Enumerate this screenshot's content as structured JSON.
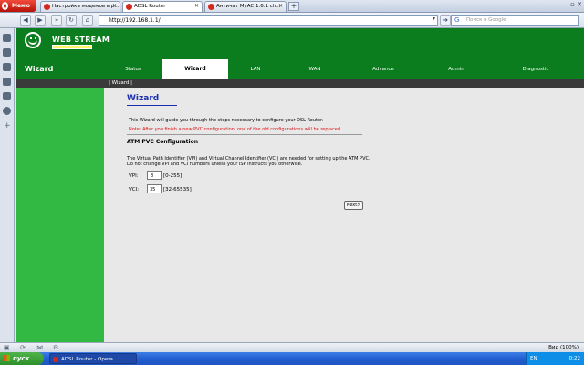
{
  "browser": {
    "menu_label": "Меню",
    "tabs": [
      {
        "label": "Настройка модемов в р..."
      },
      {
        "label": "ADSL Router"
      },
      {
        "label": "Античат MyAC 1.6.1 ch..."
      }
    ],
    "new_tab": "+",
    "window_controls": "— ▫ ✕",
    "address": "http://192.168.1.1/",
    "search_placeholder": "Поиск в Google"
  },
  "router": {
    "brand": "WEB STREAM",
    "section_title": "Wizard",
    "nav": [
      {
        "label": "Status"
      },
      {
        "label": "Wizard"
      },
      {
        "label": "LAN"
      },
      {
        "label": "WAN"
      },
      {
        "label": "Advance"
      },
      {
        "label": "Admin"
      },
      {
        "label": "Diagnostic"
      }
    ],
    "subnav": "| Wizard |",
    "page_title": "Wizard",
    "intro": "This Wizard will guide you through the steps necessary to configure your DSL Router.",
    "note": "Note: After you finish a new PVC configuration, one of the old configurations will be replaced.",
    "section_heading": "ATM PVC Configuration",
    "description_line1": "The Virtual Path Identifier (VPI) and Virtual Channel Identifier (VCI) are needed for setting up the ATM PVC.",
    "description_line2": "Do not change VPI and VCI numbers unless your ISP instructs you otherwise.",
    "vpi_label": "VPI:",
    "vpi_value": "8",
    "vpi_range": "[0-255]",
    "vci_label": "VCI:",
    "vci_value": "35",
    "vci_range": "[32-65535]",
    "next_label": "Next>"
  },
  "status": {
    "zoom": "Вид (100%)"
  },
  "taskbar": {
    "start_label": "пуск",
    "task_label": "ADSL Router - Opera",
    "lang": "EN",
    "clock": "0:22"
  }
}
